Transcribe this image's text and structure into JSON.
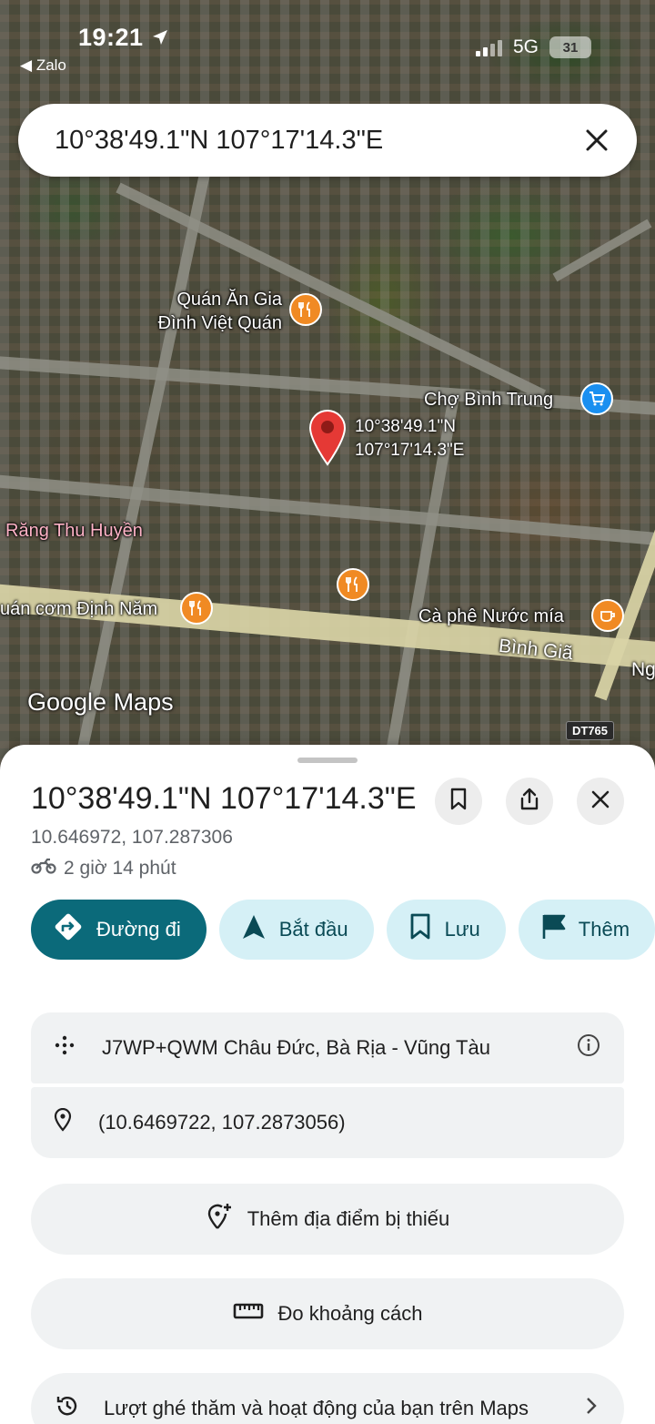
{
  "status_bar": {
    "time": "19:21",
    "back_app": "Zalo",
    "network": "5G",
    "battery": "31"
  },
  "search": {
    "query": "10°38'49.1\"N 107°17'14.3\"E"
  },
  "map": {
    "pois": [
      {
        "name": "Quán Ăn Gia\nĐình Việt Quán",
        "category": "restaurant"
      },
      {
        "name": "Chợ Bình Trung",
        "category": "market"
      },
      {
        "name": "Răng Thu Huyền",
        "category": "dentist"
      },
      {
        "name": "uán cơm Định Năm",
        "category": "restaurant"
      },
      {
        "name": "Cà phê Nước mía",
        "category": "cafe"
      }
    ],
    "pin_label": "10°38'49.1\"N\n107°17'14.3\"E",
    "road_label_1": "Bình Giã",
    "road_label_2": "Ng",
    "route_badge": "DT765",
    "logo": "Google Maps"
  },
  "place": {
    "title": "10°38'49.1\"N 107°17'14.3\"E",
    "decimal": "10.646972, 107.287306",
    "travel_time": "2 giờ 14 phút"
  },
  "actions": [
    {
      "label": "Đường đi",
      "icon": "directions-icon"
    },
    {
      "label": "Bắt đầu",
      "icon": "navigation-arrow-icon"
    },
    {
      "label": "Lưu",
      "icon": "bookmark-icon"
    },
    {
      "label": "Thêm",
      "icon": "flag-icon"
    }
  ],
  "details": {
    "plus_code": "J7WP+QWM Châu Đức, Bà Rịa - Vũng Tàu",
    "coordinates": "(10.6469722, 107.2873056)"
  },
  "buttons": {
    "add_missing_place": "Thêm địa điểm bị thiếu",
    "measure_distance": "Đo khoảng cách",
    "visits_activity": "Lượt ghé thăm và hoạt động của bạn trên Maps"
  },
  "colors": {
    "primary_teal": "#0b6a7a",
    "chip_light": "#d5f0f6",
    "pin_red": "#e53935",
    "food_orange": "#f08a24",
    "shop_blue": "#1a8ff0"
  }
}
